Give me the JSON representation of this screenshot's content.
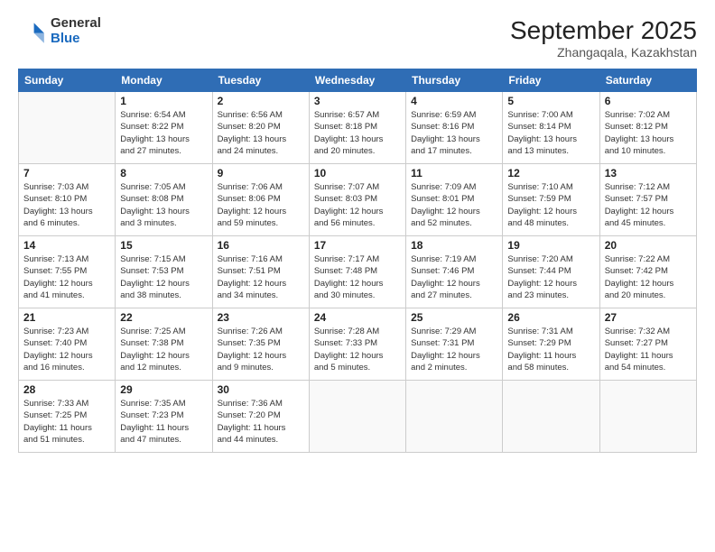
{
  "header": {
    "logo_general": "General",
    "logo_blue": "Blue",
    "month_title": "September 2025",
    "location": "Zhangaqala, Kazakhstan"
  },
  "weekdays": [
    "Sunday",
    "Monday",
    "Tuesday",
    "Wednesday",
    "Thursday",
    "Friday",
    "Saturday"
  ],
  "weeks": [
    [
      {
        "day": "",
        "info": ""
      },
      {
        "day": "1",
        "info": "Sunrise: 6:54 AM\nSunset: 8:22 PM\nDaylight: 13 hours\nand 27 minutes."
      },
      {
        "day": "2",
        "info": "Sunrise: 6:56 AM\nSunset: 8:20 PM\nDaylight: 13 hours\nand 24 minutes."
      },
      {
        "day": "3",
        "info": "Sunrise: 6:57 AM\nSunset: 8:18 PM\nDaylight: 13 hours\nand 20 minutes."
      },
      {
        "day": "4",
        "info": "Sunrise: 6:59 AM\nSunset: 8:16 PM\nDaylight: 13 hours\nand 17 minutes."
      },
      {
        "day": "5",
        "info": "Sunrise: 7:00 AM\nSunset: 8:14 PM\nDaylight: 13 hours\nand 13 minutes."
      },
      {
        "day": "6",
        "info": "Sunrise: 7:02 AM\nSunset: 8:12 PM\nDaylight: 13 hours\nand 10 minutes."
      }
    ],
    [
      {
        "day": "7",
        "info": "Sunrise: 7:03 AM\nSunset: 8:10 PM\nDaylight: 13 hours\nand 6 minutes."
      },
      {
        "day": "8",
        "info": "Sunrise: 7:05 AM\nSunset: 8:08 PM\nDaylight: 13 hours\nand 3 minutes."
      },
      {
        "day": "9",
        "info": "Sunrise: 7:06 AM\nSunset: 8:06 PM\nDaylight: 12 hours\nand 59 minutes."
      },
      {
        "day": "10",
        "info": "Sunrise: 7:07 AM\nSunset: 8:03 PM\nDaylight: 12 hours\nand 56 minutes."
      },
      {
        "day": "11",
        "info": "Sunrise: 7:09 AM\nSunset: 8:01 PM\nDaylight: 12 hours\nand 52 minutes."
      },
      {
        "day": "12",
        "info": "Sunrise: 7:10 AM\nSunset: 7:59 PM\nDaylight: 12 hours\nand 48 minutes."
      },
      {
        "day": "13",
        "info": "Sunrise: 7:12 AM\nSunset: 7:57 PM\nDaylight: 12 hours\nand 45 minutes."
      }
    ],
    [
      {
        "day": "14",
        "info": "Sunrise: 7:13 AM\nSunset: 7:55 PM\nDaylight: 12 hours\nand 41 minutes."
      },
      {
        "day": "15",
        "info": "Sunrise: 7:15 AM\nSunset: 7:53 PM\nDaylight: 12 hours\nand 38 minutes."
      },
      {
        "day": "16",
        "info": "Sunrise: 7:16 AM\nSunset: 7:51 PM\nDaylight: 12 hours\nand 34 minutes."
      },
      {
        "day": "17",
        "info": "Sunrise: 7:17 AM\nSunset: 7:48 PM\nDaylight: 12 hours\nand 30 minutes."
      },
      {
        "day": "18",
        "info": "Sunrise: 7:19 AM\nSunset: 7:46 PM\nDaylight: 12 hours\nand 27 minutes."
      },
      {
        "day": "19",
        "info": "Sunrise: 7:20 AM\nSunset: 7:44 PM\nDaylight: 12 hours\nand 23 minutes."
      },
      {
        "day": "20",
        "info": "Sunrise: 7:22 AM\nSunset: 7:42 PM\nDaylight: 12 hours\nand 20 minutes."
      }
    ],
    [
      {
        "day": "21",
        "info": "Sunrise: 7:23 AM\nSunset: 7:40 PM\nDaylight: 12 hours\nand 16 minutes."
      },
      {
        "day": "22",
        "info": "Sunrise: 7:25 AM\nSunset: 7:38 PM\nDaylight: 12 hours\nand 12 minutes."
      },
      {
        "day": "23",
        "info": "Sunrise: 7:26 AM\nSunset: 7:35 PM\nDaylight: 12 hours\nand 9 minutes."
      },
      {
        "day": "24",
        "info": "Sunrise: 7:28 AM\nSunset: 7:33 PM\nDaylight: 12 hours\nand 5 minutes."
      },
      {
        "day": "25",
        "info": "Sunrise: 7:29 AM\nSunset: 7:31 PM\nDaylight: 12 hours\nand 2 minutes."
      },
      {
        "day": "26",
        "info": "Sunrise: 7:31 AM\nSunset: 7:29 PM\nDaylight: 11 hours\nand 58 minutes."
      },
      {
        "day": "27",
        "info": "Sunrise: 7:32 AM\nSunset: 7:27 PM\nDaylight: 11 hours\nand 54 minutes."
      }
    ],
    [
      {
        "day": "28",
        "info": "Sunrise: 7:33 AM\nSunset: 7:25 PM\nDaylight: 11 hours\nand 51 minutes."
      },
      {
        "day": "29",
        "info": "Sunrise: 7:35 AM\nSunset: 7:23 PM\nDaylight: 11 hours\nand 47 minutes."
      },
      {
        "day": "30",
        "info": "Sunrise: 7:36 AM\nSunset: 7:20 PM\nDaylight: 11 hours\nand 44 minutes."
      },
      {
        "day": "",
        "info": ""
      },
      {
        "day": "",
        "info": ""
      },
      {
        "day": "",
        "info": ""
      },
      {
        "day": "",
        "info": ""
      }
    ]
  ]
}
